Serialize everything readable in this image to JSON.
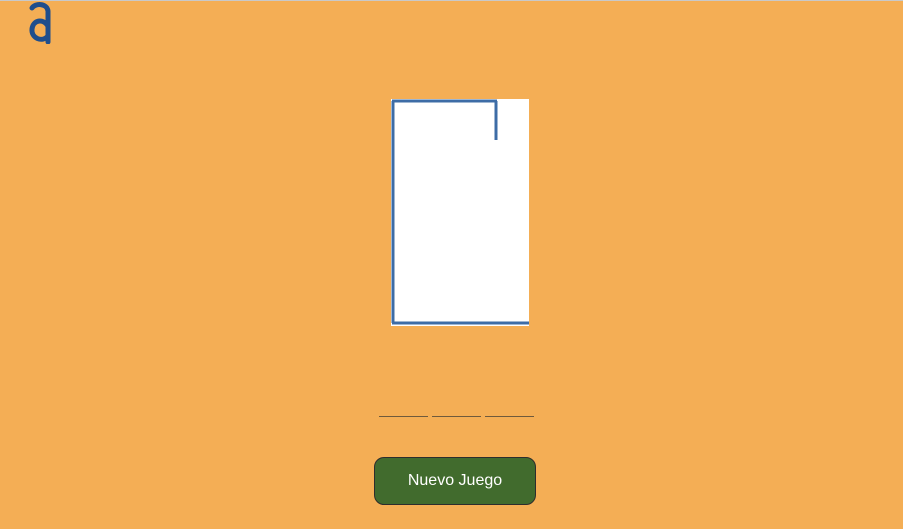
{
  "logo": {
    "icon": "brand-a-icon",
    "color": "#1F4E8C"
  },
  "board": {
    "background": "#FFFFFF",
    "line_color": "#3D6CA6"
  },
  "word": {
    "letter_count": 3
  },
  "actions": {
    "new_game_label": "Nuevo Juego"
  },
  "colors": {
    "background": "#F4AE55",
    "button": "#416B2D",
    "button_text": "#FFFFFF"
  }
}
